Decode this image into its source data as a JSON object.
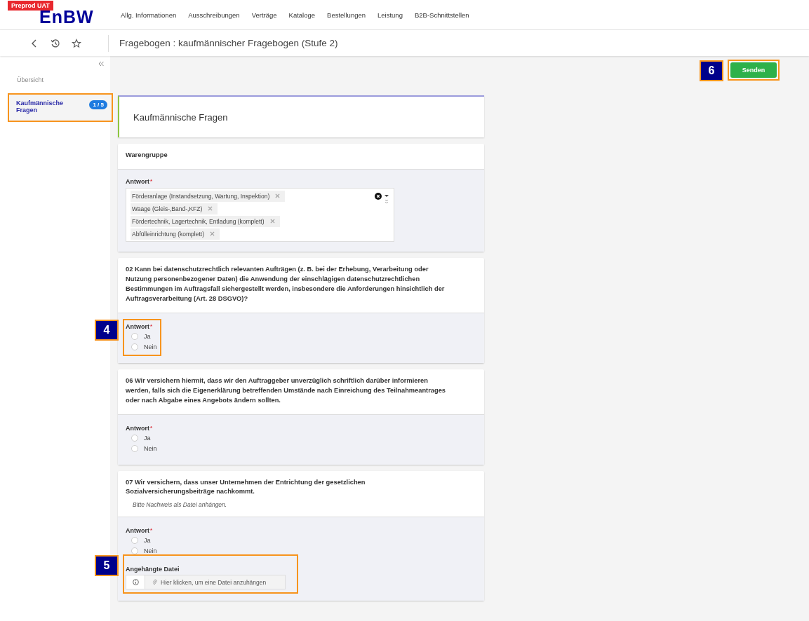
{
  "env_badge": "Preprod UAT",
  "logo": "EnBW",
  "nav": [
    "Allg. Informationen",
    "Ausschreibungen",
    "Verträge",
    "Kataloge",
    "Bestellungen",
    "Leistung",
    "B2B-Schnittstellen"
  ],
  "page_title": "Fragebogen : kaufmännischer Fragebogen (Stufe 2)",
  "sidebar": {
    "items": [
      {
        "label": "Übersicht",
        "selected": false,
        "highlighted": false
      },
      {
        "label": "Kaufmännische Fragen",
        "selected": true,
        "highlighted": true,
        "badge": "1 / 5"
      }
    ]
  },
  "send_button": {
    "label": "Senden",
    "callout": "6"
  },
  "section_title": "Kaufmännische Fragen",
  "questions": [
    {
      "kind": "multiselect",
      "text": "Warengruppe",
      "answer_label": "Antwort",
      "required_mark": "*",
      "tags": [
        "Förderanlage (Instandsetzung, Wartung, Inspektion)",
        "Waage (Gleis-,Band-,KFZ)",
        "Fördertechnik, Lagertechnik, Entladung (komplett)",
        "Abfülleinrichtung (komplett)"
      ]
    },
    {
      "kind": "radio",
      "text": "02 Kann bei datenschutzrechtlich relevanten Aufträgen (z. B. bei der Erhebung, Verarbeitung oder Nutzung personenbezogener Daten) die Anwendung der einschlägigen datenschutzrechtlichen Bestimmungen im Auftragsfall sichergestellt werden, insbesondere die Anforderungen hinsichtlich der Auftragsverarbeitung (Art. 28 DSGVO)?",
      "answer_label": "Antwort",
      "required_mark": "*",
      "callout": "4",
      "options": [
        {
          "label": "Ja",
          "selected": false
        },
        {
          "label": "Nein",
          "selected": false
        }
      ]
    },
    {
      "kind": "radio",
      "text": "06 Wir versichern hiermit, dass wir den Auftraggeber unverzüglich schriftlich darüber informieren werden, falls sich die Eigenerklärung betreffenden Umstände nach Einreichung des Teilnahmeantrages oder nach Abgabe eines Angebots ändern sollten.",
      "answer_label": "Antwort",
      "required_mark": "*",
      "options": [
        {
          "label": "Ja",
          "selected": false
        },
        {
          "label": "Nein",
          "selected": false
        }
      ]
    },
    {
      "kind": "radio",
      "text": "07 Wir versichern, dass unser Unternehmen der Entrichtung der gesetzlichen Sozialversicherungsbeiträge nachkommt.",
      "hint": "Bitte Nachweis als Datei anhängen.",
      "answer_label": "Antwort",
      "required_mark": "*",
      "options": [
        {
          "label": "Ja",
          "selected": false
        },
        {
          "label": "Nein",
          "selected": false
        }
      ],
      "attachment": {
        "label": "Angehängte Datei",
        "placeholder": "Hier klicken, um eine Datei anzuhängen",
        "callout": "5"
      }
    }
  ]
}
